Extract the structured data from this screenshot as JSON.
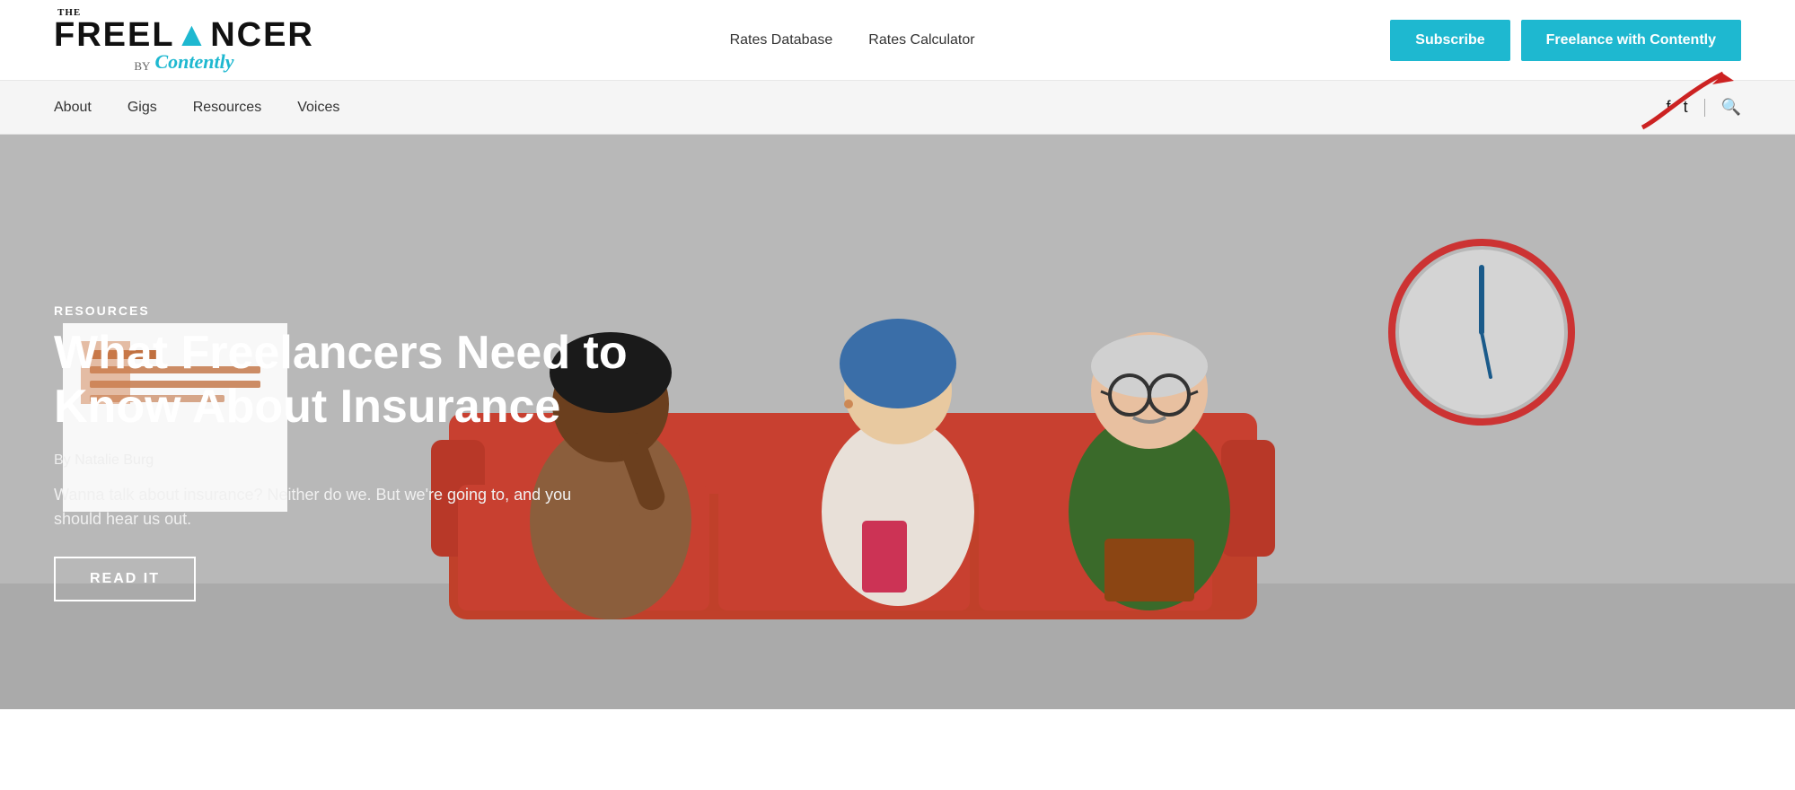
{
  "header": {
    "logo": {
      "the": "THE",
      "freelancer": "FREEL",
      "caret": "▲",
      "freelancer2": "NCER",
      "by": "BY",
      "contently": "Contently"
    },
    "nav": {
      "rates_database": "Rates Database",
      "rates_calculator": "Rates Calculator"
    },
    "buttons": {
      "subscribe": "Subscribe",
      "freelance": "Freelance with Contently"
    }
  },
  "secondary_nav": {
    "links": {
      "about": "About",
      "gigs": "Gigs",
      "resources": "Resources",
      "voices": "Voices"
    }
  },
  "hero": {
    "category": "RESOURCES",
    "title": "What Freelancers Need to Know About Insurance",
    "author": "By Natalie Burg",
    "description": "Wanna talk about insurance? Neither do we. But we're going to, and you should hear us out.",
    "cta": "READ IT"
  },
  "colors": {
    "teal": "#1eb8d0",
    "red_arrow": "#cc2222",
    "hero_bg": "#b5b5b5"
  }
}
